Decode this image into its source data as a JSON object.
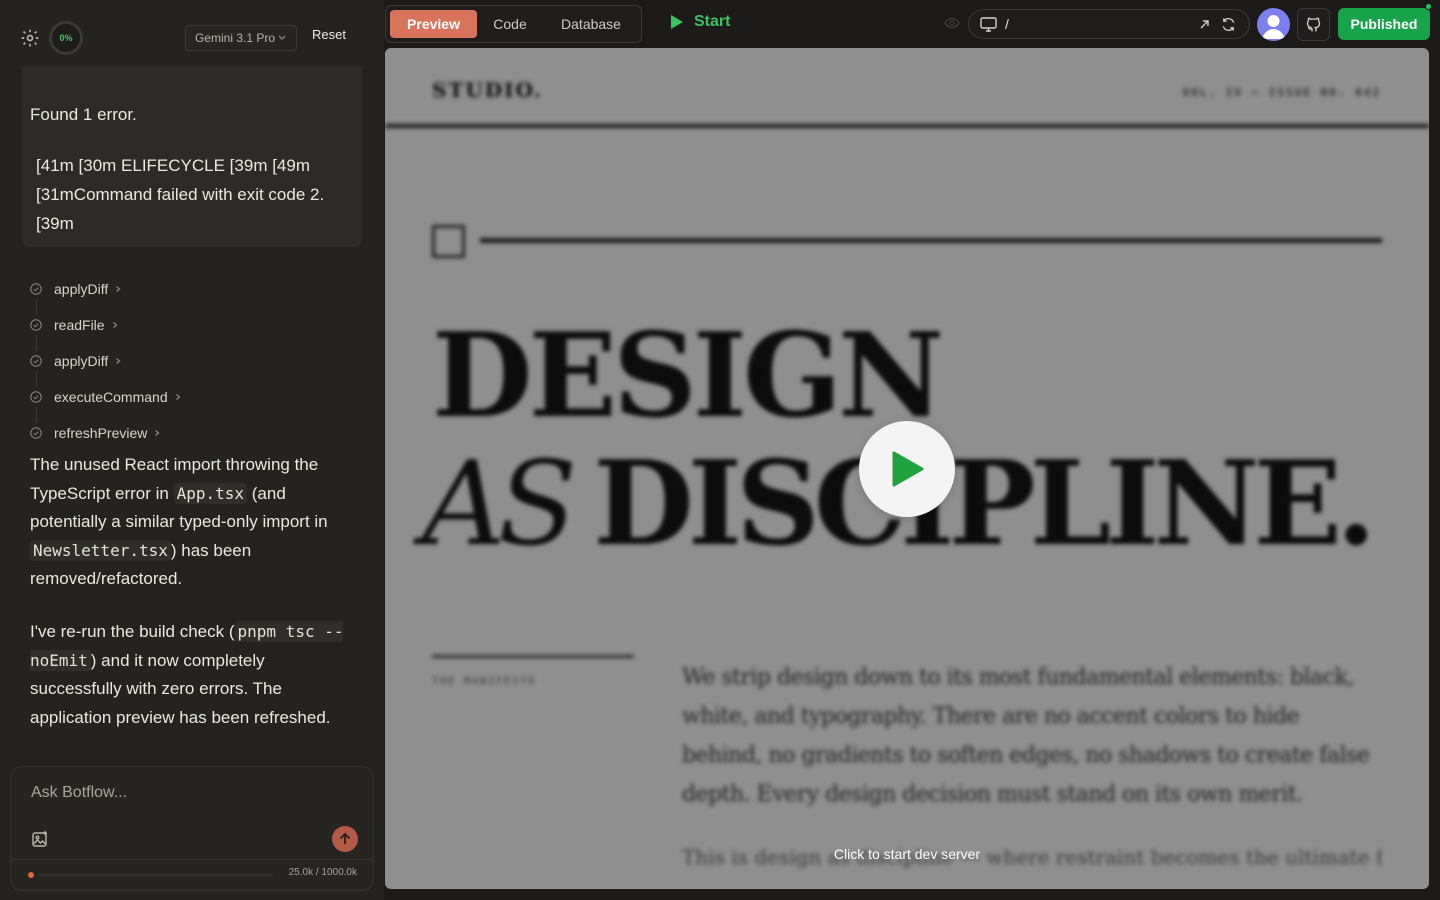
{
  "topbar_left": {
    "progress_label": "0%",
    "model_label": "Gemini 3.1 Pro",
    "reset_label": "Reset"
  },
  "chat": {
    "error_title": "Found 1 error.",
    "error_detail": "[41m [30m ELIFECYCLE  [39m [49m [31mCommand failed with exit code 2. [39m",
    "tools": [
      {
        "label": "applyDiff",
        "icon": "check-icon"
      },
      {
        "label": "readFile",
        "icon": "check-icon"
      },
      {
        "label": "applyDiff",
        "icon": "check-icon"
      },
      {
        "label": "executeCommand",
        "icon": "check-icon"
      },
      {
        "label": "refreshPreview",
        "icon": "check-icon"
      }
    ],
    "msg1": {
      "p1": "The unused React import throwing the TypeScript error in ",
      "code1": "App.tsx",
      "p2": " (and potentially a similar typed-only import in ",
      "code2": "Newsletter.tsx",
      "p3": ") has been removed/refactored."
    },
    "msg2": {
      "p1": "I've re-run the build check (",
      "code1": "pnpm tsc --noEmit",
      "p2": ") and it now completely successfully with zero errors. The application preview has been refreshed."
    }
  },
  "composer": {
    "placeholder": "Ask Botflow...",
    "token_count": "25.0k / 1000.0k",
    "token_fraction": 0.025
  },
  "topbar_right": {
    "tabs": [
      "Preview",
      "Code",
      "Database"
    ],
    "active_tab": "Preview",
    "start_label": "Start",
    "url_path": "/",
    "published_label": "Published"
  },
  "preview": {
    "brand": "STUDIO.",
    "issue": "VOL. IV — ISSUE NO. 042",
    "headline_1": "DESIGN",
    "headline_2_italic": "AS",
    "headline_2": "DISCIPLINE.",
    "manifesto_label": "THE MANIFESTO",
    "body": "We strip design down to its most fundamental elements: black, white, and typography. There are no accent colors to hide behind, no gradients to soften edges, no shadows to create false depth. Every design decision must stand on its own merit.",
    "body_2": "This is design as discipline — where restraint becomes the ultimate form of",
    "start_hint": "Click to start dev server"
  },
  "colors": {
    "accent_tab": "#d8735c",
    "start_green": "#38c45c",
    "published_green": "#17a34a",
    "send_button": "#b45a46"
  }
}
